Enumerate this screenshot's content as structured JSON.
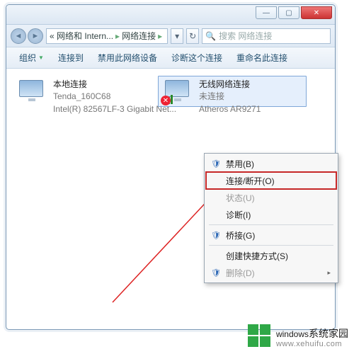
{
  "titlebar": {
    "min": "—",
    "max": "▢",
    "close": "✕"
  },
  "breadcrumb": {
    "seg1": "« 网络和 Intern...",
    "seg2": "网络连接"
  },
  "search": {
    "placeholder": "搜索 网络连接"
  },
  "toolbar": {
    "organize": "组织",
    "connect": "连接到",
    "disable": "禁用此网络设备",
    "diagnose": "诊断这个连接",
    "rename": "重命名此连接"
  },
  "connections": {
    "lan": {
      "title": "本地连接",
      "line2": "Tenda_160C68",
      "line3": "Intel(R) 82567LF-3 Gigabit Net..."
    },
    "wlan": {
      "title": "无线网络连接",
      "line2": "未连接",
      "line3": "Atheros AR9271"
    }
  },
  "context_menu": {
    "disable": "禁用(B)",
    "connect": "连接/断开(O)",
    "status": "状态(U)",
    "diagnose": "诊断(I)",
    "bridge": "桥接(G)",
    "shortcut": "创建快捷方式(S)",
    "delete": "删除(D)"
  },
  "watermark": {
    "brand": "windows",
    "sub": "系统家园",
    "url": "www.xehuifu.com"
  }
}
